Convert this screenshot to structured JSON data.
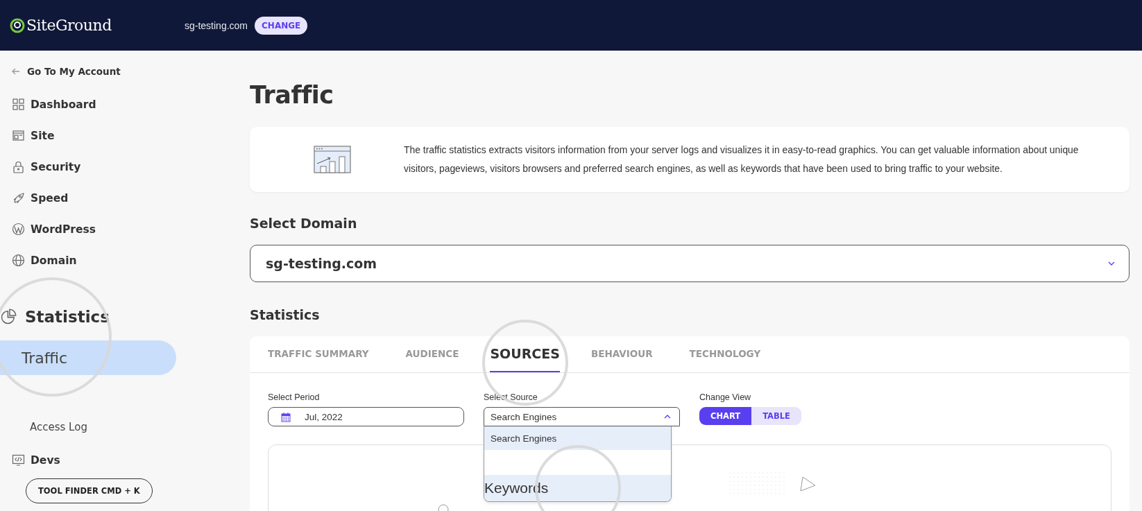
{
  "header": {
    "logo": "SiteGround",
    "domain": "sg-testing.com",
    "change_button": "CHANGE"
  },
  "sidebar": {
    "back_link": "Go To My Account",
    "items": [
      {
        "label": "Dashboard",
        "kind": "section",
        "selected": false,
        "magnified": false
      },
      {
        "label": "Site",
        "kind": "section",
        "selected": false,
        "magnified": false
      },
      {
        "label": "Security",
        "kind": "section",
        "selected": false,
        "magnified": false
      },
      {
        "label": "Speed",
        "kind": "section",
        "selected": false,
        "magnified": false
      },
      {
        "label": "WordPress",
        "kind": "section",
        "selected": false,
        "magnified": false
      },
      {
        "label": "Domain",
        "kind": "section",
        "selected": false,
        "magnified": false
      },
      {
        "label": "Statistics",
        "kind": "section",
        "selected": false,
        "magnified": true
      },
      {
        "label": "Traffic",
        "kind": "subitem",
        "selected": true,
        "magnified": true
      },
      {
        "label": "Access Log",
        "kind": "subitem",
        "selected": false,
        "magnified": false
      },
      {
        "label": "Devs",
        "kind": "section",
        "selected": false,
        "magnified": false
      }
    ],
    "tool_finder": "TOOL FINDER CMD + K"
  },
  "main": {
    "title": "Traffic",
    "intro": "The traffic statistics extracts visitors information from your server logs and visualizes it in easy-to-read graphics. You can get valuable information about unique visitors, pageviews, visitors browsers and preferred search engines, as well as keywords that have been used to bring traffic to your website.",
    "domain_heading": "Select Domain",
    "domain_value": "sg-testing.com",
    "statistics_heading": "Statistics",
    "tabs": [
      {
        "label": "TRAFFIC SUMMARY",
        "selected": false,
        "magnified": false
      },
      {
        "label": "AUDIENCE",
        "selected": false,
        "magnified": false
      },
      {
        "label": "SOURCES",
        "selected": true,
        "magnified": true
      },
      {
        "label": "BEHAVIOUR",
        "selected": false,
        "magnified": false
      },
      {
        "label": "TECHNOLOGY",
        "selected": false,
        "magnified": false
      }
    ],
    "period": {
      "label": "Select Period",
      "value": "Jul, 2022"
    },
    "source": {
      "label": "Select Source",
      "value": "Search Engines",
      "expanded": true,
      "options": [
        {
          "label": "Search Engines",
          "highlighted": true,
          "magnified": false
        },
        {
          "label": "Keywords",
          "highlighted": true,
          "magnified": true
        }
      ]
    },
    "view": {
      "label": "Change View",
      "options": [
        {
          "label": "CHART",
          "selected": true
        },
        {
          "label": "TABLE",
          "selected": false
        }
      ]
    }
  }
}
